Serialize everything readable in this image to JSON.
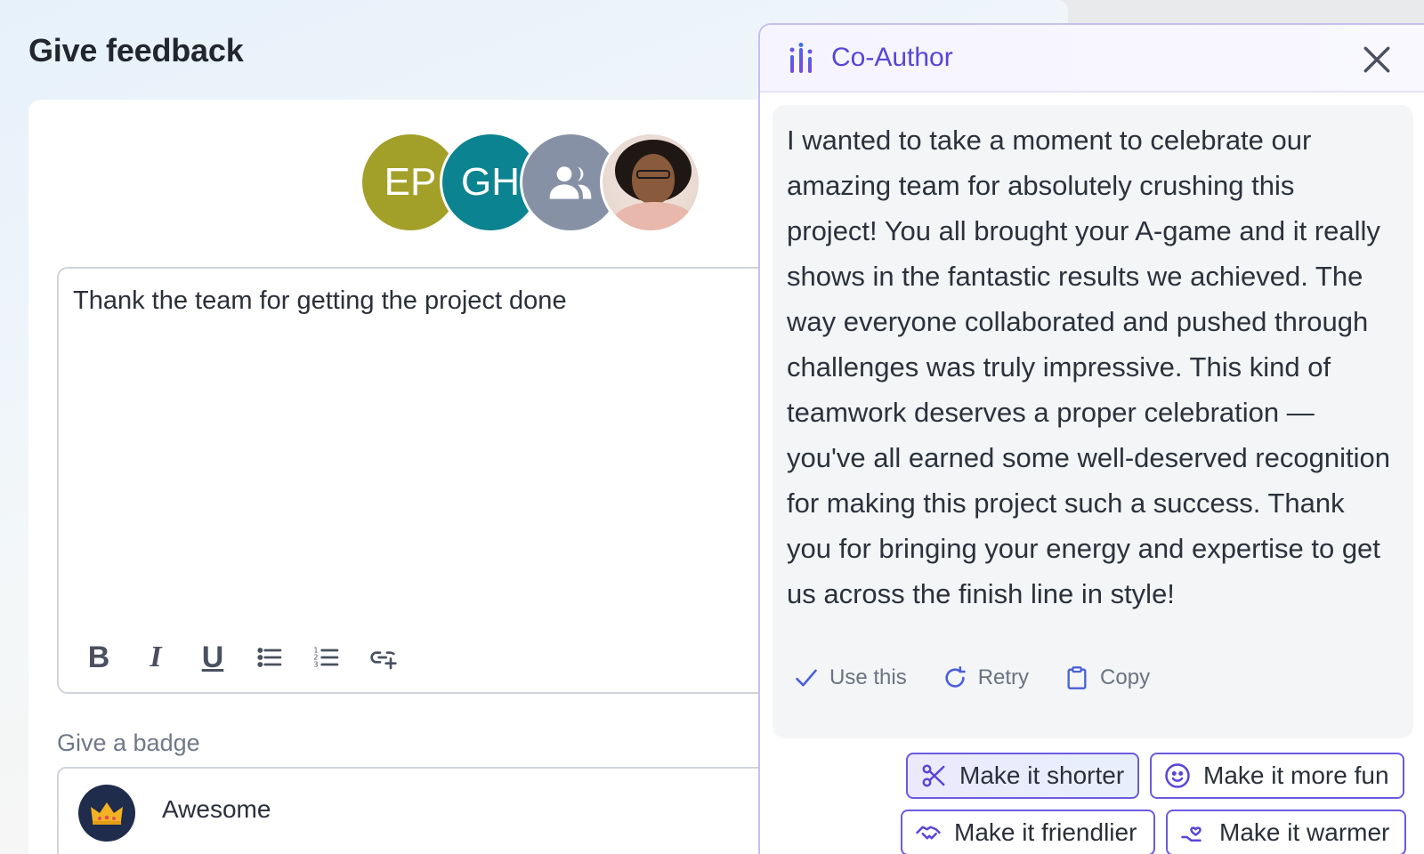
{
  "page": {
    "title": "Give feedback"
  },
  "recipients": [
    {
      "initials": "EP",
      "color": "#a3a02a"
    },
    {
      "initials": "GH",
      "color": "#0c8390"
    },
    {
      "icon": "group-icon",
      "color": "#8791a5"
    },
    {
      "icon": "person-photo"
    }
  ],
  "editor": {
    "text": "Thank the team for getting the project done",
    "toolbar": {
      "bold": "B",
      "italic": "I",
      "underline": "U",
      "icons": [
        "bold-icon",
        "italic-icon",
        "underline-icon",
        "bullet-list-icon",
        "numbered-list-icon",
        "insert-link-icon"
      ]
    }
  },
  "badge": {
    "label": "Give a badge",
    "value": "Awesome",
    "icon": "crown-icon"
  },
  "coauthor": {
    "title": "Co-Author",
    "message": "I wanted to take a moment to celebrate our amazing team for absolutely crushing this project! You all brought your A-game and it really shows in the fantastic results we achieved. The way everyone collaborated and pushed through challenges was truly impressive. This kind of teamwork deserves a proper celebration — you've all earned some well-deserved recognition for making this project such a success. Thank you for bringing your energy and expertise to get us across the finish line in style!",
    "actions": {
      "use": "Use this",
      "retry": "Retry",
      "copy": "Copy"
    },
    "suggestions": {
      "shorter": "Make it shorter",
      "fun": "Make it more fun",
      "friendlier": "Make it friendlier",
      "warmer": "Make it warmer"
    }
  },
  "colors": {
    "accent": "#5845d8",
    "chip_border": "#6b5ae0"
  }
}
